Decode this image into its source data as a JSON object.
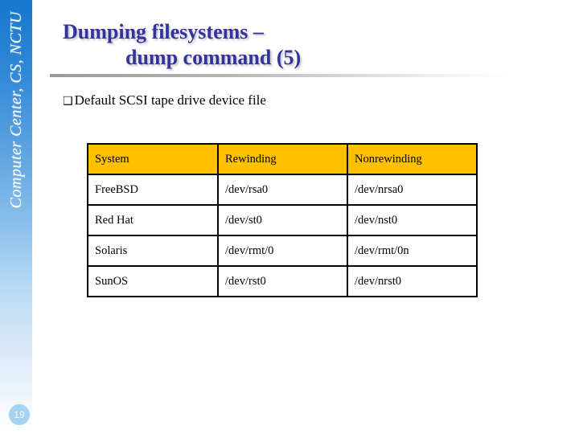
{
  "sidebar": {
    "label": "Computer Center, CS, NCTU",
    "page_number": "19",
    "gradient_top_color": "#1478CE",
    "gradient_bottom_color": "#FFFFFF",
    "badge_color": "#A4D2F2"
  },
  "title": {
    "line1": "Dumping filesystems –",
    "line2": "dump command (5)",
    "color": "#333399"
  },
  "content": {
    "bullet_glyph": "❑",
    "bullet_text": "Default SCSI tape drive device file"
  },
  "table": {
    "header_color": "#FFC000",
    "border_color": "#000000",
    "columns": [
      "System",
      "Rewinding",
      "Nonrewinding"
    ],
    "rows": [
      {
        "system": "FreeBSD",
        "rewinding": "/dev/rsa0",
        "nonrewinding": "/dev/nrsa0"
      },
      {
        "system": "Red Hat",
        "rewinding": "/dev/st0",
        "nonrewinding": "/dev/nst0"
      },
      {
        "system": "Solaris",
        "rewinding": "/dev/rmt/0",
        "nonrewinding": "/dev/rmt/0n"
      },
      {
        "system": "SunOS",
        "rewinding": "/dev/rst0",
        "nonrewinding": "/dev/nrst0"
      }
    ]
  }
}
